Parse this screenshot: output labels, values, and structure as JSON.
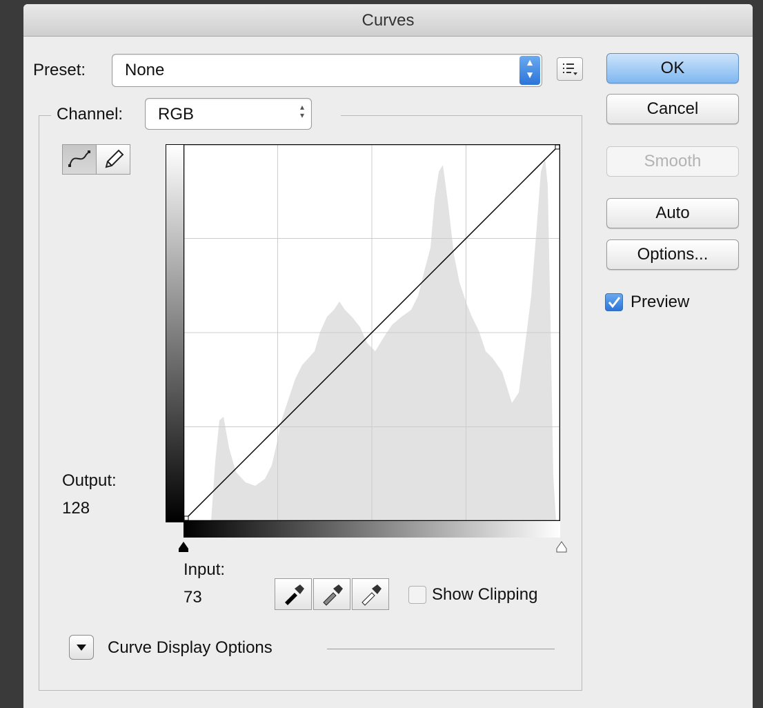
{
  "window": {
    "title": "Curves"
  },
  "preset": {
    "label": "Preset:",
    "value": "None",
    "menu_icon": "list-menu-icon"
  },
  "channel": {
    "label": "Channel:",
    "value": "RGB"
  },
  "buttons": {
    "ok": "OK",
    "cancel": "Cancel",
    "smooth": "Smooth",
    "auto": "Auto",
    "options": "Options..."
  },
  "preview": {
    "label": "Preview",
    "checked": true
  },
  "tools": {
    "curve": "curve-point-icon",
    "pencil": "pencil-icon"
  },
  "output": {
    "label": "Output:",
    "value": "128"
  },
  "input": {
    "label": "Input:",
    "value": "73"
  },
  "eyedroppers": [
    "black-eyedropper-icon",
    "gray-eyedropper-icon",
    "white-eyedropper-icon"
  ],
  "show_clipping": {
    "label": "Show Clipping",
    "checked": false
  },
  "curve_display": {
    "label": "Curve Display Options"
  },
  "colors": {
    "accent": "#2c74d8",
    "histogram": "#e2e2e2",
    "grid": "#cccccc"
  }
}
